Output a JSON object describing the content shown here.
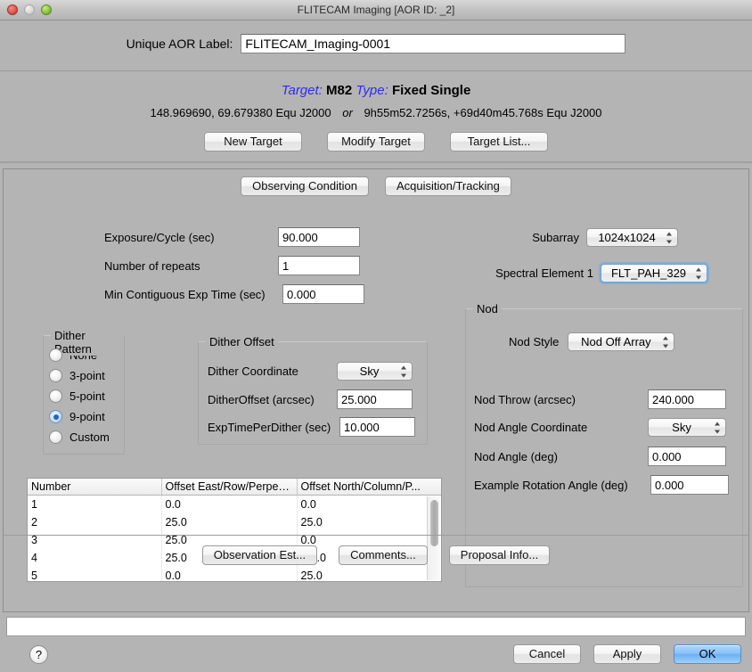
{
  "window": {
    "title": "FLITECAM Imaging [AOR ID: _2]",
    "controls": [
      "close-icon",
      "minimize-icon",
      "zoom-icon"
    ]
  },
  "aor": {
    "label": "Unique AOR Label:",
    "value": "FLITECAM_Imaging-0001"
  },
  "target": {
    "target_key": "Target:",
    "target_value": "M82",
    "type_key": "Type:",
    "type_value": "Fixed Single",
    "coords_decimal": "148.969690, 69.679380",
    "coords_decimal_frame": "Equ J2000",
    "or": "or",
    "coords_sexagesimal": "9h55m52.7256s, +69d40m45.768s",
    "coords_sexagesimal_frame": "Equ J2000",
    "buttons": [
      {
        "label": "New Target"
      },
      {
        "label": "Modify Target"
      },
      {
        "label": "Target List..."
      }
    ]
  },
  "tabs": [
    {
      "label": "Observing Condition"
    },
    {
      "label": "Acquisition/Tracking"
    }
  ],
  "exposure": {
    "exposure_cycle_label": "Exposure/Cycle (sec)",
    "exposure_cycle_value": "90.000",
    "repeats_label": "Number of repeats",
    "repeats_value": "1",
    "min_contiguous_label": "Min Contiguous Exp Time (sec)",
    "min_contiguous_value": "0.000"
  },
  "instrument": {
    "subarray_label": "Subarray",
    "subarray_value": "1024x1024",
    "spectral_element_label": "Spectral Element 1",
    "spectral_element_value": "FLT_PAH_329"
  },
  "dither_pattern": {
    "legend": "Dither Pattern",
    "options": [
      {
        "label": "None",
        "selected": false
      },
      {
        "label": "3-point",
        "selected": false
      },
      {
        "label": "5-point",
        "selected": false
      },
      {
        "label": "9-point",
        "selected": true
      },
      {
        "label": "Custom",
        "selected": false
      }
    ]
  },
  "dither_offset": {
    "legend": "Dither Offset",
    "coordinate_label": "Dither Coordinate",
    "coordinate_value": "Sky",
    "offset_label": "DitherOffset (arcsec)",
    "offset_value": "25.000",
    "exptime_label": "ExpTimePerDither (sec)",
    "exptime_value": "10.000"
  },
  "nod": {
    "legend": "Nod",
    "style_label": "Nod Style",
    "style_value": "Nod Off Array",
    "throw_label": "Nod Throw (arcsec)",
    "throw_value": "240.000",
    "angle_coord_label": "Nod Angle Coordinate",
    "angle_coord_value": "Sky",
    "angle_label": "Nod Angle (deg)",
    "angle_value": "0.000",
    "rotation_label": "Example Rotation Angle (deg)",
    "rotation_value": "0.000"
  },
  "dither_table": {
    "columns": [
      "Number",
      "Offset East/Row/Perpen...",
      "Offset North/Column/P..."
    ],
    "rows": [
      [
        "1",
        "0.0",
        "0.0"
      ],
      [
        "2",
        "25.0",
        "25.0"
      ],
      [
        "3",
        "25.0",
        "0.0"
      ],
      [
        "4",
        "25.0",
        "-25.0"
      ],
      [
        "5",
        "0.0",
        "25.0"
      ]
    ]
  },
  "panel_actions": [
    {
      "label": "Observation Est..."
    },
    {
      "label": "Comments..."
    },
    {
      "label": "Proposal Info..."
    }
  ],
  "statusbar": {
    "text": ""
  },
  "footer": {
    "help_label": "?",
    "cancel_label": "Cancel",
    "apply_label": "Apply",
    "ok_label": "OK"
  },
  "colors": {
    "accent_blue": "#2d2df0",
    "default_button_blue": "#8cc1f7",
    "window_bg": "#b4b4b4",
    "radio_selected": "#2a62b8"
  }
}
